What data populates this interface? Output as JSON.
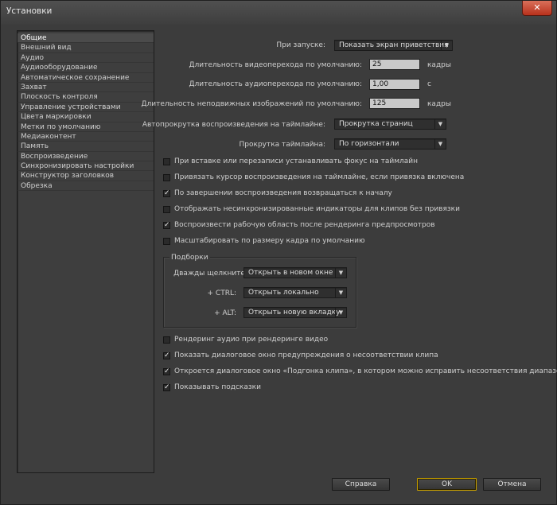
{
  "window": {
    "title": "Установки",
    "close_glyph": "✕"
  },
  "sidebar": {
    "items": [
      "Общие",
      "Внешний вид",
      "Аудио",
      "Аудиооборудование",
      "Автоматическое сохранение",
      "Захват",
      "Плоскость контроля",
      "Управление устройствами",
      "Цвета маркировки",
      "Метки по умолчанию",
      "Медиаконтент",
      "Память",
      "Воспроизведение",
      "Синхронизировать настройки",
      "Конструктор заголовков",
      "Обрезка"
    ],
    "selected_index": 0
  },
  "general": {
    "startup_label": "При запуске:",
    "startup_value": "Показать экран приветствия",
    "video_transition_label": "Длительность видеоперехода по умолчанию:",
    "video_transition_value": "25",
    "video_transition_unit": "кадры",
    "audio_transition_label": "Длительность аудиоперехода по умолчанию:",
    "audio_transition_value": "1,00",
    "audio_transition_unit": "с",
    "still_duration_label": "Длительность неподвижных изображений по умолчанию:",
    "still_duration_value": "125",
    "still_duration_unit": "кадры",
    "autoscroll_label": "Автопрокрутка воспроизведения на таймлайне:",
    "autoscroll_value": "Прокрутка страниц",
    "timeline_scroll_label": "Прокрутка таймлайна:",
    "timeline_scroll_value": "По горизонтали"
  },
  "checkboxes": [
    {
      "label": "При вставке или перезаписи устанавливать фокус на таймлайн",
      "checked": false
    },
    {
      "label": "Привязать курсор воспроизведения на таймлайне, если привязка включена",
      "checked": false
    },
    {
      "label": "По завершении воспроизведения возвращаться к началу",
      "checked": true
    },
    {
      "label": "Отображать несинхронизированные индикаторы для клипов без привязки",
      "checked": false
    },
    {
      "label": "Воспроизвести рабочую область после рендеринга предпросмотров",
      "checked": true
    },
    {
      "label": "Масштабировать по размеру кадра по умолчанию",
      "checked": false
    }
  ],
  "bins": {
    "title": "Подборки",
    "double_click_label": "Дважды щелкните:",
    "double_click_value": "Открыть в новом окне",
    "ctrl_label": "+ CTRL:",
    "ctrl_value": "Открыть локально",
    "alt_label": "+ ALT:",
    "alt_value": "Открыть новую вкладку"
  },
  "checkboxes2": [
    {
      "label": "Рендеринг аудио при рендеринге видео",
      "checked": false
    },
    {
      "label": "Показать диалоговое окно предупреждения о несоответствии клипа",
      "checked": true
    },
    {
      "label": "Откроется диалоговое окно «Подгонка клипа», в котором можно исправить несоответствия диапазона",
      "checked": true
    },
    {
      "label": "Показывать подсказки",
      "checked": true
    }
  ],
  "buttons": {
    "help": "Справка",
    "ok": "OK",
    "cancel": "Отмена"
  },
  "icons": {
    "check": "✓",
    "caret": "▼"
  }
}
